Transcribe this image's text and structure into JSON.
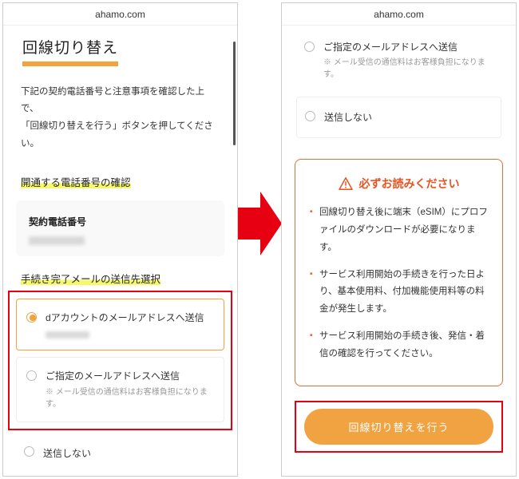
{
  "url": "ahamo.com",
  "left": {
    "title": "回線切り替え",
    "intro_l1": "下記の契約電話番号と注意事項を確認した上で、",
    "intro_l2": "「回線切り替えを行う」ボタンを押してください。",
    "section_phone": "開通する電話番号の確認",
    "contract_phone_label": "契約電話番号",
    "section_mail": "手続き完了メールの送信先選択",
    "opt1": "dアカウントのメールアドレスへ送信",
    "opt2": "ご指定のメールアドレスへ送信",
    "opt2_note": "※ メール受信の通信料はお客様負担になります。",
    "opt3": "送信しない"
  },
  "right": {
    "opt_a": "ご指定のメールアドレスへ送信",
    "opt_a_note": "※ メール受信の通信料はお客様負担になります。",
    "opt_b": "送信しない",
    "notice_title": "必ずお読みください",
    "notices": [
      "回線切り替え後に端末（eSIM）にプロファイルのダウンロードが必要になります。",
      "サービス利用開始の手続きを行った日より、基本使用料、付加機能使用料等の料金が発生します。",
      "サービス利用開始の手続き後、発信・着信の確認を行ってください。"
    ],
    "cta": "回線切り替えを行う"
  }
}
